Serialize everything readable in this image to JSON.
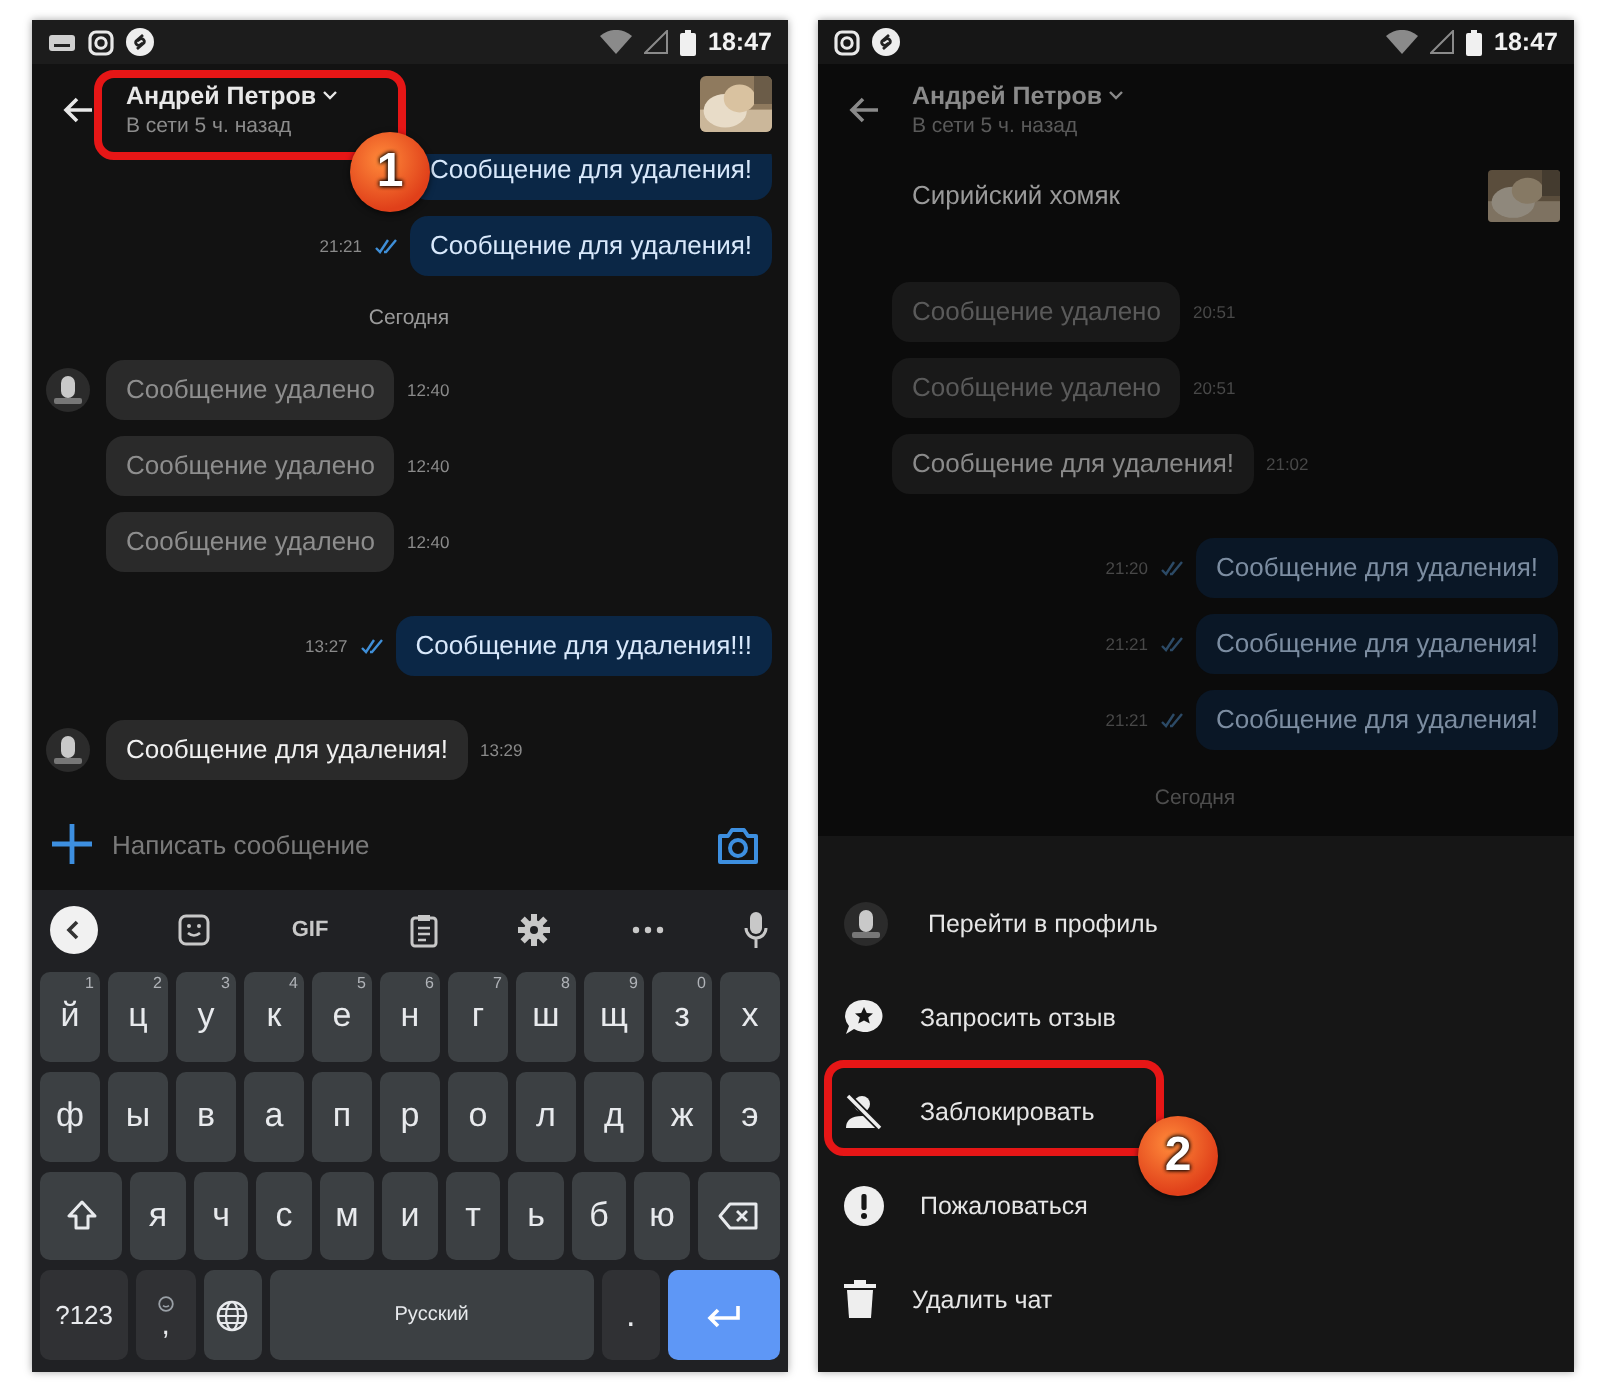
{
  "screens": [
    {
      "dimmed": false,
      "status_bar": {
        "time": "18:47"
      },
      "header": {
        "name": "Андрей Петров",
        "subtitle": "В сети 5 ч. назад",
        "photo": true
      },
      "messages": [
        {
          "kind": "outgoing",
          "text": "Сообщение для удаления!"
        },
        {
          "kind": "outgoing",
          "text": "Сообщение для удаления!",
          "time": "21:21"
        },
        {
          "kind": "date",
          "text": "Сегодня"
        },
        {
          "kind": "incoming",
          "text": "Сообщение удалено",
          "time": "12:40",
          "deleted": true,
          "show_avatar": true
        },
        {
          "kind": "incoming",
          "text": "Сообщение удалено",
          "time": "12:40",
          "deleted": true,
          "show_avatar": false
        },
        {
          "kind": "incoming",
          "text": "Сообщение удалено",
          "time": "12:40",
          "deleted": true,
          "show_avatar": false
        },
        {
          "kind": "outgoing",
          "text": "Сообщение для удаления!!!",
          "time": "13:27"
        },
        {
          "kind": "incoming",
          "text": "Сообщение для удаления!",
          "time": "13:29",
          "deleted": false,
          "show_avatar": true
        }
      ],
      "composer": {
        "placeholder": "Написать сообщение"
      },
      "keyboard": {
        "toolbar_text": "GIF",
        "rows": [
          {
            "keys": [
              {
                "kind": "letter",
                "label": "й",
                "hint": "1"
              },
              {
                "kind": "letter",
                "label": "ц",
                "hint": "2"
              },
              {
                "kind": "letter",
                "label": "у",
                "hint": "3"
              },
              {
                "kind": "letter",
                "label": "к",
                "hint": "4"
              },
              {
                "kind": "letter",
                "label": "е",
                "hint": "5"
              },
              {
                "kind": "letter",
                "label": "н",
                "hint": "6"
              },
              {
                "kind": "letter",
                "label": "г",
                "hint": "7"
              },
              {
                "kind": "letter",
                "label": "ш",
                "hint": "8"
              },
              {
                "kind": "letter",
                "label": "щ",
                "hint": "9"
              },
              {
                "kind": "letter",
                "label": "з",
                "hint": "0"
              },
              {
                "kind": "letter",
                "label": "х"
              }
            ]
          },
          {
            "keys": [
              {
                "kind": "letter",
                "label": "ф"
              },
              {
                "kind": "letter",
                "label": "ы"
              },
              {
                "kind": "letter",
                "label": "в"
              },
              {
                "kind": "letter",
                "label": "а"
              },
              {
                "kind": "letter",
                "label": "п"
              },
              {
                "kind": "letter",
                "label": "р"
              },
              {
                "kind": "letter",
                "label": "о"
              },
              {
                "kind": "letter",
                "label": "л"
              },
              {
                "kind": "letter",
                "label": "д"
              },
              {
                "kind": "letter",
                "label": "ж"
              },
              {
                "kind": "letter",
                "label": "э"
              }
            ]
          },
          {
            "keys": [
              {
                "kind": "shift"
              },
              {
                "kind": "letter",
                "label": "я"
              },
              {
                "kind": "letter",
                "label": "ч"
              },
              {
                "kind": "letter",
                "label": "с"
              },
              {
                "kind": "letter",
                "label": "м"
              },
              {
                "kind": "letter",
                "label": "и"
              },
              {
                "kind": "letter",
                "label": "т"
              },
              {
                "kind": "letter",
                "label": "ь"
              },
              {
                "kind": "letter",
                "label": "б"
              },
              {
                "kind": "letter",
                "label": "ю"
              },
              {
                "kind": "backspace"
              }
            ]
          },
          {
            "keys": [
              {
                "kind": "symbols",
                "label": "?123"
              },
              {
                "kind": "comma",
                "label": ","
              },
              {
                "kind": "globe"
              },
              {
                "kind": "space",
                "label": "Русский"
              },
              {
                "kind": "period",
                "label": "."
              },
              {
                "kind": "enter"
              }
            ]
          }
        ]
      },
      "callout": {
        "number": "1"
      }
    },
    {
      "dimmed": true,
      "status_bar": {
        "time": "18:47"
      },
      "header": {
        "name": "Андрей Петров",
        "subtitle": "В сети 5 ч. назад",
        "photo": false
      },
      "pinned": {
        "title": "Сирийский хомяк",
        "photo": true
      },
      "messages": [
        {
          "kind": "incoming",
          "text": "Сообщение удалено",
          "time": "20:51",
          "deleted": true,
          "show_avatar": false
        },
        {
          "kind": "incoming",
          "text": "Сообщение удалено",
          "time": "20:51",
          "deleted": true,
          "show_avatar": false
        },
        {
          "kind": "incoming",
          "text": "Сообщение для удаления!",
          "time": "21:02",
          "deleted": false,
          "show_avatar": false
        },
        {
          "kind": "outgoing",
          "text": "Сообщение для удаления!",
          "time": "21:20"
        },
        {
          "kind": "outgoing",
          "text": "Сообщение для удаления!",
          "time": "21:21"
        },
        {
          "kind": "outgoing",
          "text": "Сообщение для удаления!",
          "time": "21:21"
        },
        {
          "kind": "date",
          "text": "Сегодня"
        }
      ],
      "menu": [
        {
          "kind": "profile",
          "label": "Перейти в профиль"
        },
        {
          "kind": "feedback",
          "label": "Запросить отзыв"
        },
        {
          "kind": "block",
          "label": "Заблокировать"
        },
        {
          "kind": "report",
          "label": "Пожаловаться"
        },
        {
          "kind": "delete",
          "label": "Удалить чат"
        }
      ],
      "callout": {
        "number": "2"
      }
    }
  ]
}
